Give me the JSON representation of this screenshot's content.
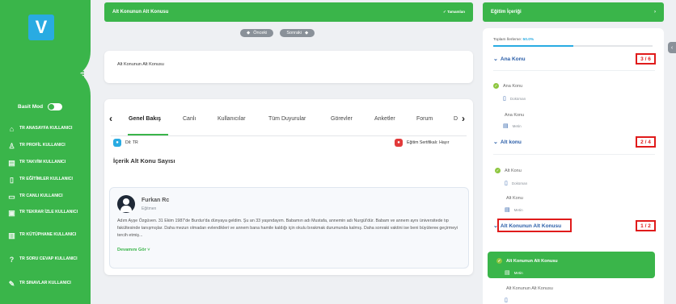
{
  "app": {
    "logo_letter": "V"
  },
  "sidebar": {
    "mode_label": "Basit Mod",
    "items": [
      {
        "label": "TR ANASAYFA KULLANICI",
        "icon": "home-icon"
      },
      {
        "label": "TR PROFİL KULLANICI",
        "icon": "user-icon"
      },
      {
        "label": "TR TAKVİM KULLANICI",
        "icon": "calendar-icon"
      },
      {
        "label": "TR EĞİTİMLER KULLANICI",
        "icon": "book-icon"
      },
      {
        "label": "TR CANLI KULLANICI",
        "icon": "live-icon"
      },
      {
        "label": "TR TEKRAR İZLE KULLANICI",
        "icon": "replay-icon"
      },
      {
        "label": "TR KÜTÜPHANE KULLANICI",
        "icon": "library-icon"
      },
      {
        "label": "TR SORU CEVAP KULLANICI",
        "icon": "question-icon"
      },
      {
        "label": "TR SINAVLAR KULLANICI",
        "icon": "exam-icon"
      }
    ]
  },
  "header": {
    "title": "Alt Konunun Alt Konusu",
    "done_label": "Tamamlan",
    "prev_label": "Önceki",
    "next_label": "Sonraki"
  },
  "subtitle_card": {
    "text": "Alt Konunun Alt Konusu"
  },
  "tabs": [
    "Genel Bakış",
    "Canlı",
    "Kullanıcılar",
    "Tüm Duyurular",
    "Görevler",
    "Anketler",
    "Forum",
    "D"
  ],
  "meta": {
    "language": "Dil: TR",
    "certificate": "Eğitim Sertifikalı: Hayır"
  },
  "section_title": "İçerik Alt Konu Sayısı",
  "instructor": {
    "name": "Furkan Rc",
    "role": "Eğitmen",
    "bio": "Adım Ayşe Özgüven. 31 Ekim 1987'de Burdur'da dünyaya geldim. Şu an 33 yaşındayım. Babamın adı Mustafa, annemin adı Nurgül'dür. Babam ve annem aynı üniversitede tıp fakültesinde tanışmışlar. Daha mezun olmadan evlendikleri ve annem bana hamile kaldığı için okulu bırakmak durumunda kalmış. Daha sonraki vaktini ise beni büyütereк geçirmeyi tercih etmiş...",
    "more_label": "Devamını Gör"
  },
  "right_panel": {
    "title": "Eğitim İçeriği",
    "progress_label": "Toplam İlerleme:",
    "progress_value": "50.0%",
    "progress_fraction": 0.5,
    "groups": [
      {
        "title": "Ana Konu",
        "counter": "3 / 6"
      },
      {
        "title": "Alt konu",
        "counter": "2 / 4"
      },
      {
        "title": "Alt Konunun Alt Konusu",
        "counter": "1 / 2"
      }
    ],
    "items": [
      {
        "title": "Ana Konu",
        "sub": "Doküman"
      },
      {
        "title": "Ana Konu",
        "sub": "Metin"
      },
      {
        "title": "Alt Konu",
        "sub": "Doküman"
      },
      {
        "title": "Alt Konu",
        "sub": "Metin"
      },
      {
        "title": "Alt Konunun Alt Konusu",
        "sub": "Metin"
      },
      {
        "title": "Alt Konunun Alt Konusu",
        "sub": ""
      }
    ]
  },
  "colors": {
    "brand_green": "#3ab54a",
    "accent_blue": "#29abe2",
    "highlight_red": "#e01b1b"
  }
}
